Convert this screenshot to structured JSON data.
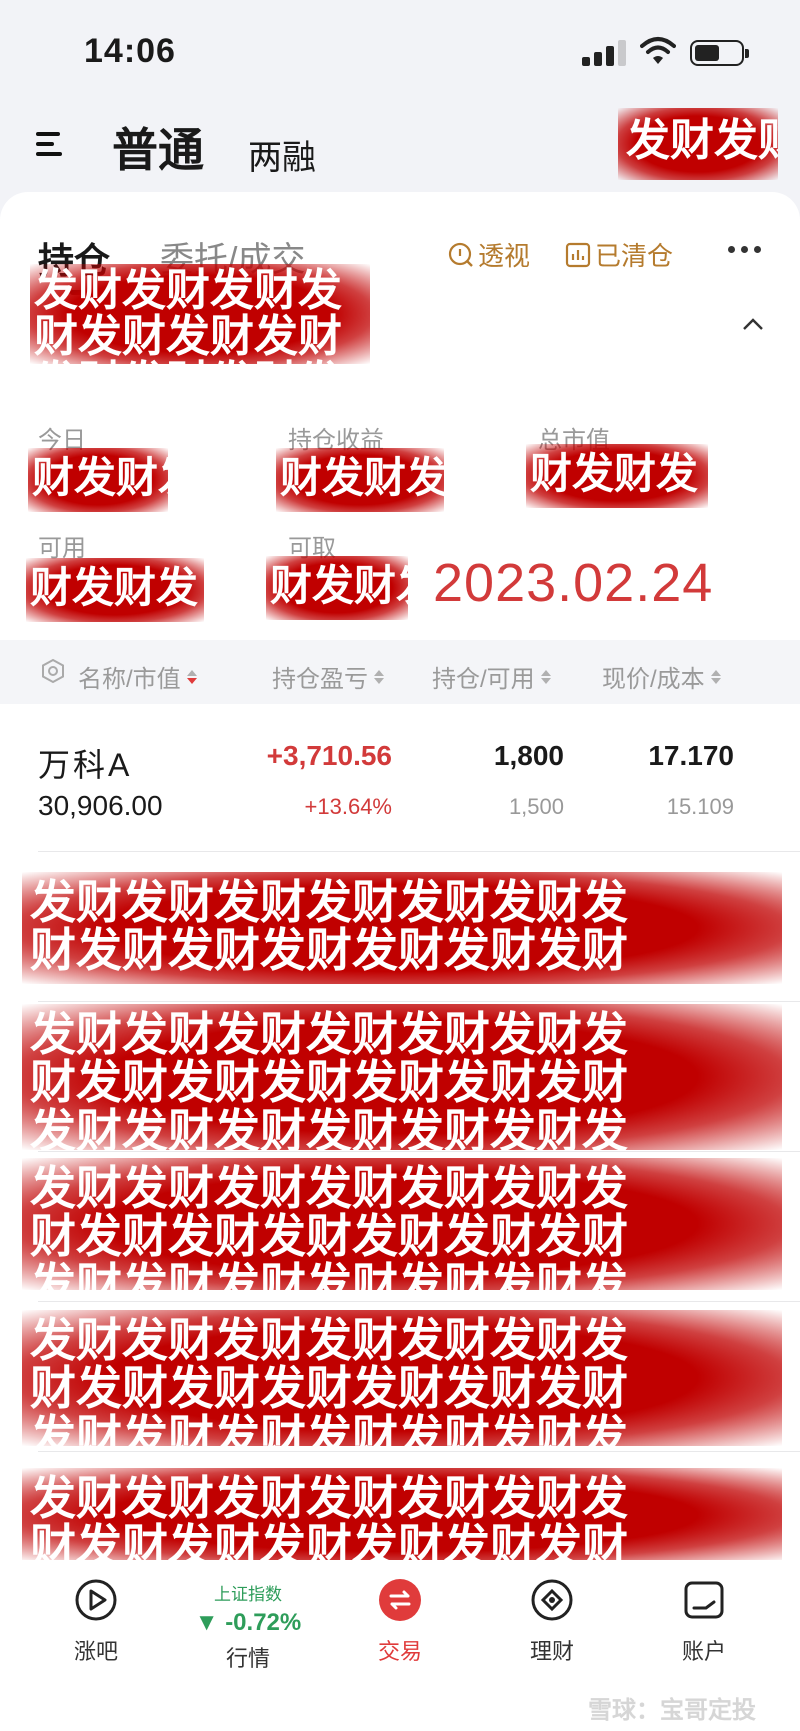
{
  "status_bar": {
    "time": "14:06",
    "icons": [
      "signal-icon",
      "wifi-icon",
      "battery-icon"
    ]
  },
  "header": {
    "menu_icon": "menu-icon",
    "tab_normal": "普通",
    "tab_margin": "两融",
    "redaction_text": "发财发财"
  },
  "tabs": {
    "holdings": "持仓",
    "orders": "委托/成交",
    "perspective": "透视",
    "cleared": "已清仓"
  },
  "summary": {
    "redaction_text": "发财发财发财发\n财发财发财发财\n发财发财发财发",
    "today_label": "今日",
    "holding_profit_label": "持仓收益",
    "market_value_label": "总市值",
    "available_label": "可用",
    "withdrawable_label": "可取",
    "redaction_short": "财发财发",
    "date_stamp": "2023.02.24"
  },
  "table": {
    "col_name": "名称/市值",
    "col_pnl": "持仓盈亏",
    "col_qty": "持仓/可用",
    "col_price": "现价/成本"
  },
  "holdings": [
    {
      "name": "万科A",
      "market_value": "30,906.00",
      "pnl": "+3,710.56",
      "pnl_pct": "+13.64%",
      "qty": "1,800",
      "qty_available": "1,500",
      "price": "17.170",
      "cost": "15.109"
    }
  ],
  "redacted_rows": [
    "发财发财发财发财发财发财发\n财发财发财发财发财发财发财",
    "发财发财发财发财发财发财发\n财发财发财发财发财发财发财\n发财发财发财发财发财发财发",
    "发财发财发财发财发财发财发\n财发财发财发财发财发财发财\n发财发财发财发财发财发财发",
    "发财发财发财发财发财发财发\n财发财发财发财发财发财发财\n发财发财发财发财发财发财发",
    "发财发财发财发财发财发财发\n财发财发财发财发财发财发财"
  ],
  "bottom_nav": {
    "items": [
      {
        "label": "涨吧",
        "icon": "play-circle-icon"
      },
      {
        "label": "行情",
        "icon": "index-ticker",
        "index_name": "上证指数",
        "index_change": "▼ -0.72%"
      },
      {
        "label": "交易",
        "icon": "swap-icon"
      },
      {
        "label": "理财",
        "icon": "diamond-coin-icon"
      },
      {
        "label": "账户",
        "icon": "account-icon"
      }
    ]
  },
  "watermark": "雪球：宝哥定投",
  "colors": {
    "accent_red": "#e03b3b",
    "gold": "#b57b2e",
    "green": "#2e9d5a",
    "redaction": "#c00000"
  }
}
